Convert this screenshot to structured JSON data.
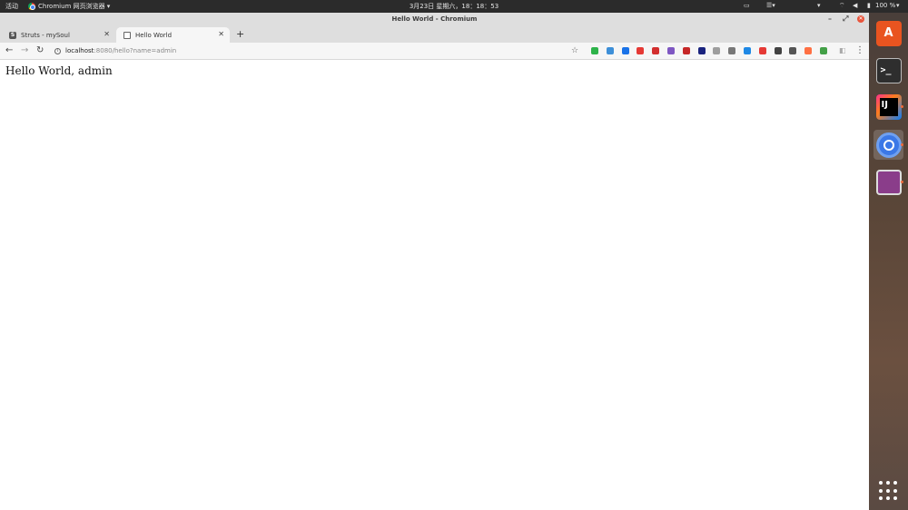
{
  "topbar": {
    "activities": "活动",
    "app_menu": "Chromium 网页浏览器 ▾",
    "clock": "3月23日 星期六，18：18：53",
    "battery": "100 %"
  },
  "window": {
    "title": "Hello World - Chromium"
  },
  "tabs": [
    {
      "title": "Struts - mySoul",
      "favicon": "s-icon"
    },
    {
      "title": "Hello World",
      "favicon": "page-icon"
    }
  ],
  "toolbar": {
    "url_host": "localhost",
    "url_path": ":8080/hello?name=admin"
  },
  "extensions": [
    {
      "name": "shield-ext-icon",
      "color": "#2db34a"
    },
    {
      "name": "sync-ext-icon",
      "color": "#3d8fd8"
    },
    {
      "name": "help-ext-icon",
      "color": "#1a73e8"
    },
    {
      "name": "red-pin-ext-icon",
      "color": "#e53935"
    },
    {
      "name": "red-circle-ext-icon",
      "color": "#d32f2f"
    },
    {
      "name": "purple-ext-icon",
      "color": "#7e57c2"
    },
    {
      "name": "red-square-ext-icon",
      "color": "#c62828"
    },
    {
      "name": "dark-blue-ext-icon",
      "color": "#1a237e"
    },
    {
      "name": "gray-box-ext-icon",
      "color": "#9e9e9e"
    },
    {
      "name": "letter-a-ext-icon",
      "color": "#777777"
    },
    {
      "name": "p-blue-ext-icon",
      "color": "#1e88e5"
    },
    {
      "name": "badge-ext-icon",
      "color": "#e53935"
    },
    {
      "name": "dark-square-ext-icon",
      "color": "#424242"
    },
    {
      "name": "gear-ext-icon",
      "color": "#555555"
    },
    {
      "name": "orange-x-ext-icon",
      "color": "#ff7043"
    },
    {
      "name": "colorful-ext-icon",
      "color": "#43a047"
    }
  ],
  "page": {
    "text": "Hello World, admin"
  },
  "colors": {
    "topbar_bg": "#2b2b2b",
    "window_chrome": "#dedede",
    "dock_accent": "#e95420"
  }
}
